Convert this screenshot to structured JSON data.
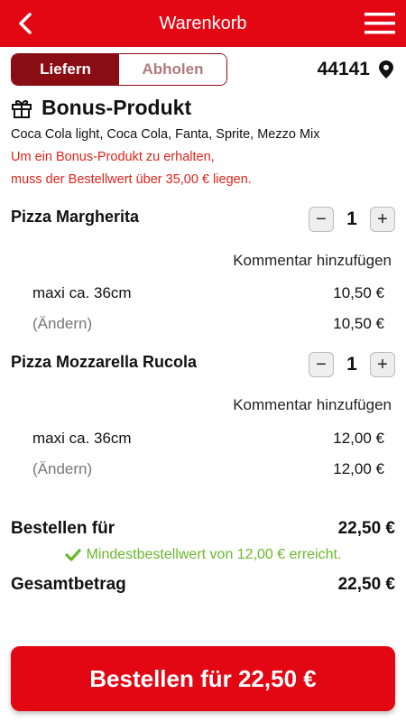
{
  "header": {
    "title": "Warenkorb",
    "back_icon": "chevron-left-icon",
    "menu_icon": "hamburger-menu-icon",
    "color": "#e30613"
  },
  "mode": {
    "deliver_label": "Liefern",
    "pickup_label": "Abholen",
    "selected": "Liefern",
    "accent": "#8b0d14"
  },
  "location": {
    "postal_code": "44141",
    "icon": "location-pin-icon"
  },
  "bonus": {
    "icon": "gift-icon",
    "title": "Bonus-Produkt",
    "options": "Coca Cola light, Coca Cola, Fanta, Sprite, Mezzo Mix",
    "note_line1": "Um ein Bonus-Produkt zu erhalten,",
    "note_line2": "muss der Bestellwert über 35,00 € liegen.",
    "note_color": "#e2231a"
  },
  "items": [
    {
      "name": "Pizza Margherita",
      "quantity": "1",
      "minus": "−",
      "plus": "+",
      "comment_label": "Kommentar hinzufügen",
      "size": "maxi ca. 36cm",
      "size_price": "10,50 €",
      "change_label": "(Ändern)",
      "total": "10,50 €"
    },
    {
      "name": "Pizza Mozzarella Rucola",
      "quantity": "1",
      "minus": "−",
      "plus": "+",
      "comment_label": "Kommentar hinzufügen",
      "size": "maxi ca. 36cm",
      "size_price": "12,00 €",
      "change_label": "(Ändern)",
      "total": "12,00 €"
    }
  ],
  "summary": {
    "order_for_label": "Bestellen für",
    "order_for_value": "22,50 €",
    "min_order_text": "Mindestbestellwert von 12,00 € erreicht.",
    "min_order_icon": "checkmark-icon",
    "min_order_color": "#6ab82d",
    "total_label": "Gesamtbetrag",
    "total_value": "22,50 €"
  },
  "order_button": {
    "label": "Bestellen für 22,50 €"
  }
}
